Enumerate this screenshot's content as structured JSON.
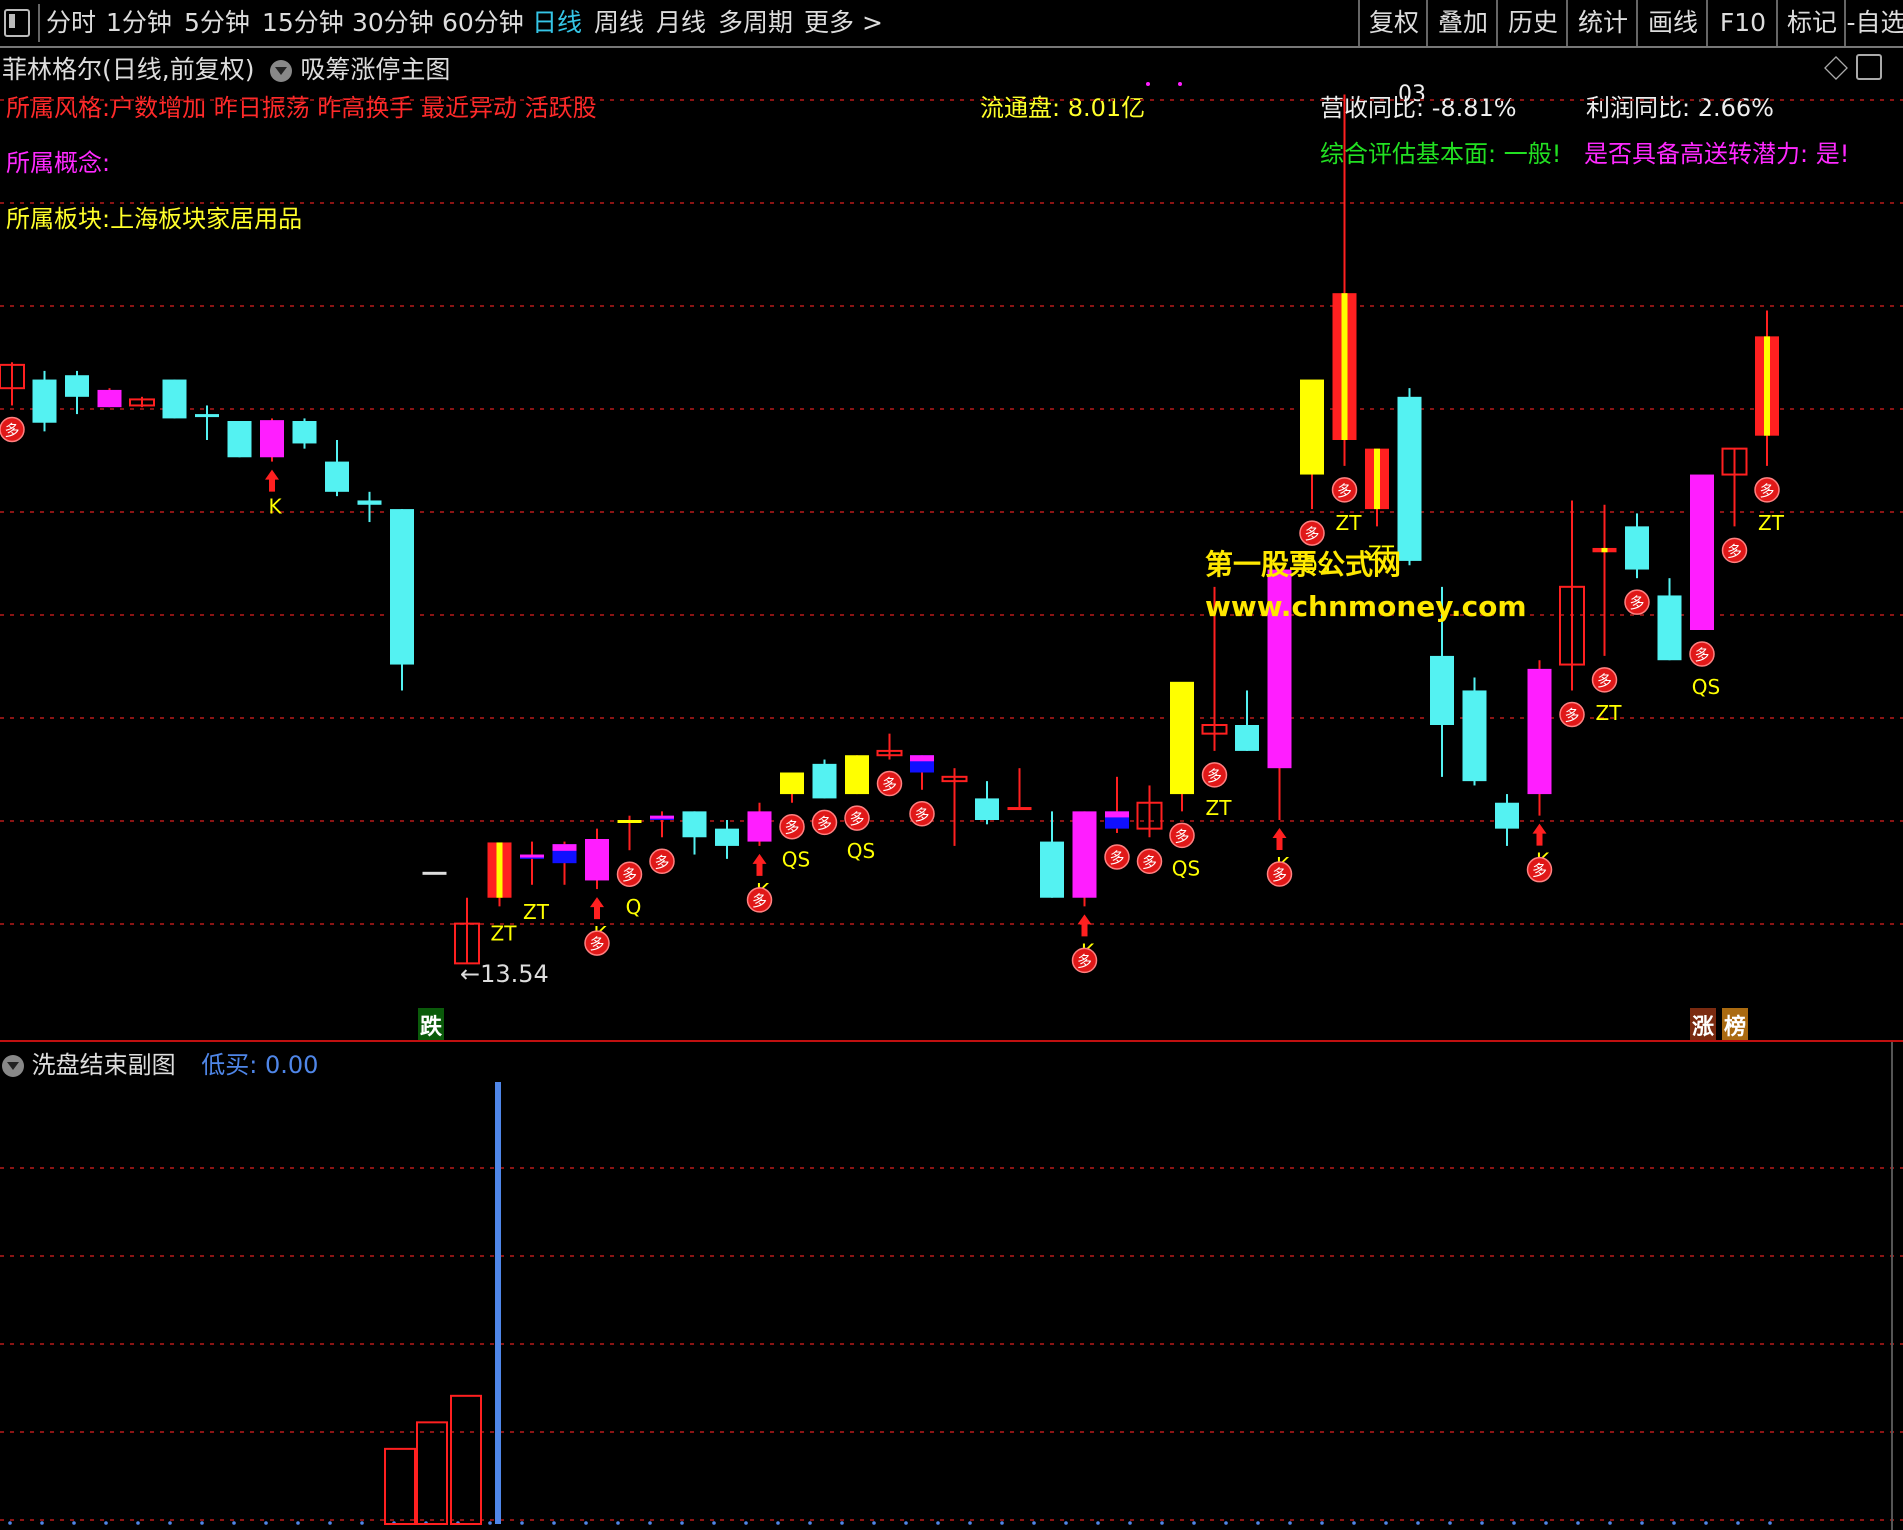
{
  "toolbar": {
    "periods": [
      "分时",
      "1分钟",
      "5分钟",
      "15分钟",
      "30分钟",
      "60分钟",
      "日线",
      "周线",
      "月线",
      "多周期",
      "更多 >"
    ],
    "active_period": "日线",
    "right_buttons": [
      "复权",
      "叠加",
      "历史",
      "统计",
      "画线",
      "F10",
      "标记",
      "-自选"
    ]
  },
  "main_header": {
    "stock_title": "菲林格尔(日线,前复权)",
    "indicator_name": "吸筹涨停主图"
  },
  "info": {
    "style_label": "所属风格:户数增加 昨日振荡 昨高换手 最近异动 活跃股",
    "concept_label": "所属概念:",
    "sector_label": "所属板块:上海板块家居用品",
    "float_shares": "流通盘: 8.01亿",
    "revenue_yoy": "营收同比: -8.81%",
    "overlap_digits": "03",
    "profit_yoy": "利润同比: 2.66%",
    "eval_label": "综合评估基本面: 一般!",
    "transfer_label": "是否具备高送转潜力: 是!"
  },
  "watermark": {
    "line1": "第一股票公式网",
    "line2": "www.chnmoney.com"
  },
  "low_price_label": "←13.54",
  "badges": {
    "die": "跌",
    "zhang": "涨",
    "bang": "榜"
  },
  "sub_header": {
    "indicator_name": "洗盘结束副图",
    "low_buy_label": "低买",
    "low_buy_value": ": 0.00"
  },
  "colors": {
    "cyan": "#54f2f2",
    "magenta": "#ff1eff",
    "yellow": "#ffff00",
    "red": "#ff2020",
    "blue": "#1010ff",
    "grid": "#8a1414",
    "sub_blue": "#4f86e8"
  },
  "chart_data": {
    "type": "candlestick",
    "price_range": [
      13.0,
      24.0
    ],
    "low_marker": 13.54,
    "candles": [
      {
        "o": 20.47,
        "h": 20.5,
        "c": 20.2,
        "l": 20.0,
        "color": "outline"
      },
      {
        "o": 20.3,
        "h": 20.4,
        "c": 19.8,
        "l": 19.7,
        "color": "cyan"
      },
      {
        "o": 20.35,
        "h": 20.4,
        "c": 20.1,
        "l": 19.9,
        "color": "cyan"
      },
      {
        "o": 20.18,
        "h": 20.2,
        "c": 19.98,
        "l": 19.98,
        "color": "magenta"
      },
      {
        "o": 20.0,
        "h": 20.1,
        "c": 20.07,
        "l": 19.98,
        "color": "outline"
      },
      {
        "o": 20.3,
        "h": 20.3,
        "c": 19.85,
        "l": 19.85,
        "color": "cyan"
      },
      {
        "o": 19.9,
        "h": 20.0,
        "c": 19.9,
        "l": 19.6,
        "color": "cyan"
      },
      {
        "o": 19.82,
        "h": 19.82,
        "c": 19.4,
        "l": 19.4,
        "color": "cyan"
      },
      {
        "o": 19.83,
        "h": 19.85,
        "c": 19.4,
        "l": 19.35,
        "color": "magenta"
      },
      {
        "o": 19.82,
        "h": 19.85,
        "c": 19.56,
        "l": 19.5,
        "color": "cyan"
      },
      {
        "o": 19.35,
        "h": 19.6,
        "c": 19.0,
        "l": 18.95,
        "color": "cyan"
      },
      {
        "o": 18.9,
        "h": 19.0,
        "c": 18.85,
        "l": 18.65,
        "color": "cyan"
      },
      {
        "o": 18.8,
        "h": 18.8,
        "c": 17.0,
        "l": 16.7,
        "color": "cyan"
      },
      {
        "o": 14.6,
        "h": 14.6,
        "c": 14.6,
        "l": 14.6,
        "color": "white"
      },
      {
        "o": 13.54,
        "h": 14.3,
        "c": 14.0,
        "l": 13.54,
        "color": "outline"
      },
      {
        "o": 14.3,
        "h": 14.5,
        "c": 14.94,
        "l": 14.2,
        "color": "zt"
      },
      {
        "o": 14.75,
        "h": 14.95,
        "c": 14.8,
        "l": 14.45,
        "color": "magentaBlue"
      },
      {
        "o": 14.7,
        "h": 14.95,
        "c": 14.92,
        "l": 14.45,
        "color": "magentaBlue"
      },
      {
        "o": 14.5,
        "h": 15.1,
        "c": 14.98,
        "l": 14.4,
        "color": "magenta"
      },
      {
        "o": 15.2,
        "h": 15.25,
        "c": 15.2,
        "l": 14.85,
        "color": "yellow"
      },
      {
        "o": 15.25,
        "h": 15.3,
        "c": 15.2,
        "l": 15.0,
        "color": "magentaBlue"
      },
      {
        "o": 15.3,
        "h": 15.3,
        "c": 15.0,
        "l": 14.8,
        "color": "cyan"
      },
      {
        "o": 15.1,
        "h": 15.2,
        "c": 14.9,
        "l": 14.75,
        "color": "cyan"
      },
      {
        "o": 14.95,
        "h": 15.4,
        "c": 15.3,
        "l": 14.9,
        "color": "magenta"
      },
      {
        "o": 15.5,
        "h": 15.7,
        "c": 15.75,
        "l": 15.4,
        "color": "yellow"
      },
      {
        "o": 15.85,
        "h": 15.9,
        "c": 15.45,
        "l": 15.45,
        "color": "cyan"
      },
      {
        "o": 15.5,
        "h": 15.95,
        "c": 15.95,
        "l": 15.5,
        "color": "yellow"
      },
      {
        "o": 15.95,
        "h": 16.2,
        "c": 16.0,
        "l": 15.9,
        "color": "outline"
      },
      {
        "o": 15.95,
        "h": 15.95,
        "c": 15.75,
        "l": 15.55,
        "color": "magentaBlue"
      },
      {
        "o": 15.7,
        "h": 15.8,
        "c": 15.65,
        "l": 14.9,
        "color": "outline"
      },
      {
        "o": 15.45,
        "h": 15.65,
        "c": 15.2,
        "l": 15.15,
        "color": "cyan"
      },
      {
        "o": 15.35,
        "h": 15.8,
        "c": 15.35,
        "l": 15.35,
        "color": "red"
      },
      {
        "o": 14.95,
        "h": 15.3,
        "c": 14.3,
        "l": 14.3,
        "color": "cyan"
      },
      {
        "o": 15.3,
        "h": 15.3,
        "c": 14.3,
        "l": 14.2,
        "color": "magenta"
      },
      {
        "o": 15.3,
        "h": 15.7,
        "c": 15.1,
        "l": 15.05,
        "color": "magentaBlue"
      },
      {
        "o": 15.4,
        "h": 15.6,
        "c": 15.1,
        "l": 15.0,
        "color": "outline"
      },
      {
        "o": 15.5,
        "h": 15.6,
        "c": 16.8,
        "l": 15.3,
        "color": "yellow"
      },
      {
        "o": 16.2,
        "h": 17.9,
        "c": 16.3,
        "l": 16.0,
        "color": "outline"
      },
      {
        "o": 16.3,
        "h": 16.7,
        "c": 16.0,
        "l": 16.0,
        "color": "cyan"
      },
      {
        "o": 18.1,
        "h": 18.1,
        "c": 15.8,
        "l": 15.2,
        "color": "magenta"
      },
      {
        "o": 19.2,
        "h": 19.4,
        "c": 20.3,
        "l": 18.8,
        "color": "yellow"
      },
      {
        "o": 19.6,
        "h": 23.6,
        "c": 21.3,
        "l": 19.3,
        "color": "zt"
      },
      {
        "o": 18.8,
        "h": 19.5,
        "c": 19.5,
        "l": 18.6,
        "color": "zt"
      },
      {
        "o": 20.1,
        "h": 20.2,
        "c": 18.2,
        "l": 18.15,
        "color": "cyan"
      },
      {
        "o": 17.1,
        "h": 17.9,
        "c": 16.3,
        "l": 15.7,
        "color": "cyan"
      },
      {
        "o": 16.7,
        "h": 16.85,
        "c": 15.65,
        "l": 15.6,
        "color": "cyan"
      },
      {
        "o": 15.4,
        "h": 15.5,
        "c": 15.1,
        "l": 14.9,
        "color": "cyan"
      },
      {
        "o": 16.95,
        "h": 17.05,
        "c": 15.5,
        "l": 15.25,
        "color": "magenta"
      },
      {
        "o": 17.9,
        "h": 18.9,
        "c": 17.0,
        "l": 16.7,
        "color": "outline"
      },
      {
        "o": 18.35,
        "h": 18.85,
        "c": 18.3,
        "l": 17.1,
        "color": "ztmark"
      },
      {
        "o": 18.6,
        "h": 18.75,
        "c": 18.1,
        "l": 18.0,
        "color": "cyan"
      },
      {
        "o": 17.8,
        "h": 18.0,
        "c": 17.05,
        "l": 17.05,
        "color": "cyan"
      },
      {
        "o": 17.4,
        "h": 17.8,
        "c": 19.2,
        "l": 17.4,
        "color": "magenta"
      },
      {
        "o": 19.2,
        "h": 19.5,
        "c": 19.5,
        "l": 18.6,
        "color": "outline"
      },
      {
        "o": 20.8,
        "h": 21.1,
        "c": 19.65,
        "l": 19.3,
        "color": "zt"
      }
    ],
    "signals": [
      {
        "i": 0,
        "type": "duo"
      },
      {
        "i": 8,
        "type": "arrowK"
      },
      {
        "i": 15,
        "type": "ZT"
      },
      {
        "i": 16,
        "type": "ZT"
      },
      {
        "i": 18,
        "type": "arrowK"
      },
      {
        "i": 18,
        "type": "duo"
      },
      {
        "i": 19,
        "type": "duo"
      },
      {
        "i": 19,
        "type": "Q"
      },
      {
        "i": 20,
        "type": "duo"
      },
      {
        "i": 23,
        "type": "arrowK"
      },
      {
        "i": 23,
        "type": "duo"
      },
      {
        "i": 24,
        "type": "duo"
      },
      {
        "i": 24,
        "type": "QS"
      },
      {
        "i": 25,
        "type": "duo"
      },
      {
        "i": 26,
        "type": "duo"
      },
      {
        "i": 26,
        "type": "QS"
      },
      {
        "i": 27,
        "type": "duo"
      },
      {
        "i": 28,
        "type": "duo"
      },
      {
        "i": 33,
        "type": "arrowK"
      },
      {
        "i": 33,
        "type": "duo"
      },
      {
        "i": 34,
        "type": "duo"
      },
      {
        "i": 35,
        "type": "duo"
      },
      {
        "i": 36,
        "type": "duo"
      },
      {
        "i": 36,
        "type": "QS"
      },
      {
        "i": 37,
        "type": "duo"
      },
      {
        "i": 37,
        "type": "ZT"
      },
      {
        "i": 39,
        "type": "arrowK"
      },
      {
        "i": 39,
        "type": "duo"
      },
      {
        "i": 40,
        "type": "duo"
      },
      {
        "i": 40,
        "type": "QS"
      },
      {
        "i": 41,
        "type": "duo"
      },
      {
        "i": 41,
        "type": "ZT"
      },
      {
        "i": 42,
        "type": "ZT"
      },
      {
        "i": 47,
        "type": "arrowK"
      },
      {
        "i": 47,
        "type": "duo"
      },
      {
        "i": 48,
        "type": "duo"
      },
      {
        "i": 49,
        "type": "duo"
      },
      {
        "i": 49,
        "type": "ZT"
      },
      {
        "i": 50,
        "type": "duo"
      },
      {
        "i": 52,
        "type": "duo"
      },
      {
        "i": 52,
        "type": "QS"
      },
      {
        "i": 53,
        "type": "duo"
      },
      {
        "i": 54,
        "type": "duo"
      },
      {
        "i": 54,
        "type": "ZT"
      }
    ],
    "sub_bars": [
      {
        "i": 11,
        "value": 0.17,
        "color": "red"
      },
      {
        "i": 12,
        "value": 0.23,
        "color": "red"
      },
      {
        "i": 13,
        "value": 0.29,
        "color": "red"
      },
      {
        "i": 14,
        "value": 1.0,
        "color": "blue"
      }
    ]
  }
}
